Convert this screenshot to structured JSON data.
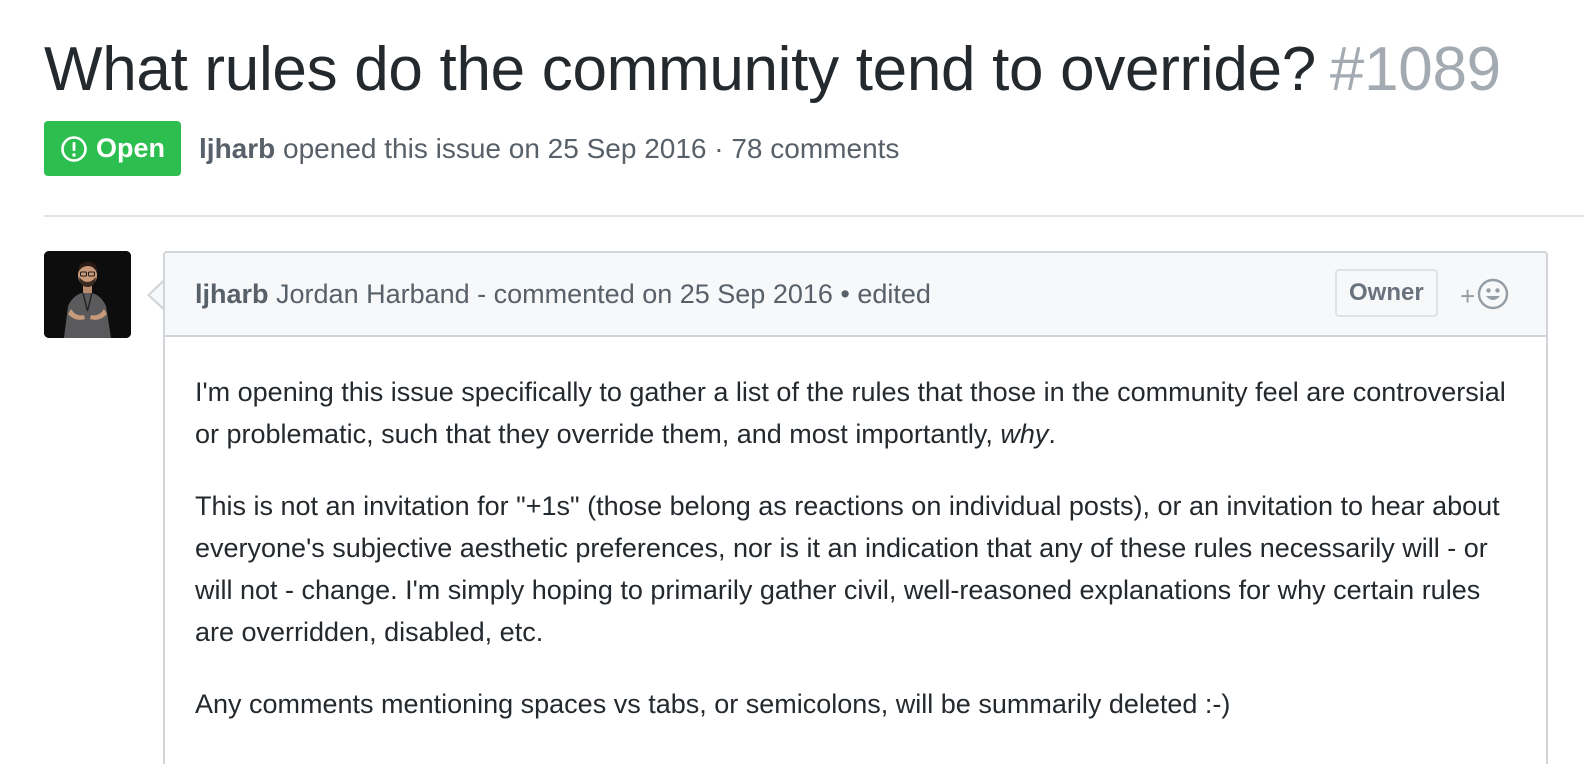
{
  "issue": {
    "title": "What rules do the community tend to override?",
    "number": "#1089",
    "state": "Open",
    "meta": {
      "author": "ljharb",
      "opened_text": "opened this issue on 25 Sep 2016 · 78 comments"
    }
  },
  "comment": {
    "author_login": "ljharb",
    "header_rest": "Jordan Harband - commented on 25 Sep 2016 • edited",
    "role_badge": "Owner",
    "reaction_plus": "+",
    "paragraphs": {
      "p1_before": "I'm opening this issue specifically to gather a list of the rules that those in the community feel are controversial or problematic, such that they override them, and most importantly, ",
      "p1_emph": "why",
      "p1_after": ".",
      "p2": "This is not an invitation for \"+1s\" (those belong as reactions on individual posts), or an invitation to hear about everyone's subjective aesthetic preferences, nor is it an indication that any of these rules necessarily will - or will not - change. I'm simply hoping to primarily gather civil, well-reasoned explanations for why certain rules are overridden, disabled, etc.",
      "p3": "Any comments mentioning spaces vs tabs, or semicolons, will be summarily deleted :-)"
    }
  },
  "icons": {
    "state": "issue-opened-icon",
    "reaction": "smiley-icon",
    "avatar": "avatar-photo"
  },
  "colors": {
    "open_green": "#2cbe4e",
    "issue_number_gray": "#a3aab1",
    "header_bg": "#f6f8fa",
    "border": "#d1d5da"
  }
}
